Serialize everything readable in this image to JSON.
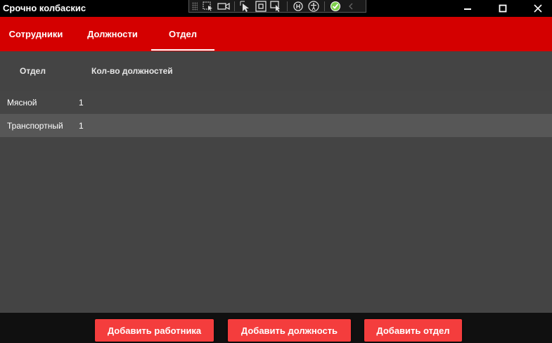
{
  "window": {
    "title": "Срочно колбаскис"
  },
  "devtools": {
    "icons": [
      "grip-icon",
      "select-element-icon",
      "video-icon",
      "pointer-icon",
      "display-layout-icon",
      "track-focus-icon",
      "hot-reload-icon",
      "accessibility-icon",
      "checkmark-icon",
      "collapse-chevron-icon"
    ]
  },
  "tabs": [
    {
      "label": "Сотрудники",
      "active": false
    },
    {
      "label": "Должности",
      "active": false
    },
    {
      "label": "Отдел",
      "active": true
    }
  ],
  "table": {
    "columns": [
      "Отдел",
      "Кол-во должностей"
    ],
    "rows": [
      [
        "Мясной",
        "1"
      ],
      [
        "Транспортный",
        "1"
      ]
    ]
  },
  "footer": {
    "buttons": [
      "Добавить работника",
      "Добавить должность",
      "Добавить отдел"
    ]
  },
  "colors": {
    "accent": "#d40000",
    "button": "#f43d3d",
    "content_bg": "#444444",
    "selected_row": "#575757"
  }
}
